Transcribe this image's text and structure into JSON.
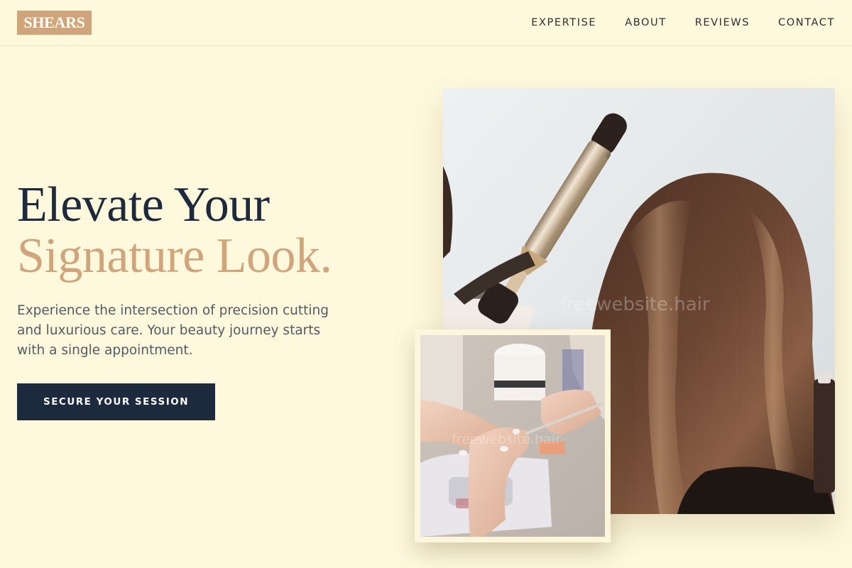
{
  "brand": {
    "logo": "SHEARS",
    "accent": "#d1a57b",
    "dark": "#1d2a3d",
    "background": "#fef8dd"
  },
  "nav": {
    "items": [
      "EXPERTISE",
      "ABOUT",
      "REVIEWS",
      "CONTACT"
    ]
  },
  "hero": {
    "headline_line1": "Elevate Your",
    "headline_line2": "Signature Look.",
    "subtext": "Experience the intersection of precision cutting and luxurious care. Your beauty journey starts with a single appointment.",
    "cta_label": "SECURE YOUR SESSION"
  },
  "images": {
    "main_watermark": "freewebsite.hair",
    "small_watermark": "freewebsite.hair"
  }
}
